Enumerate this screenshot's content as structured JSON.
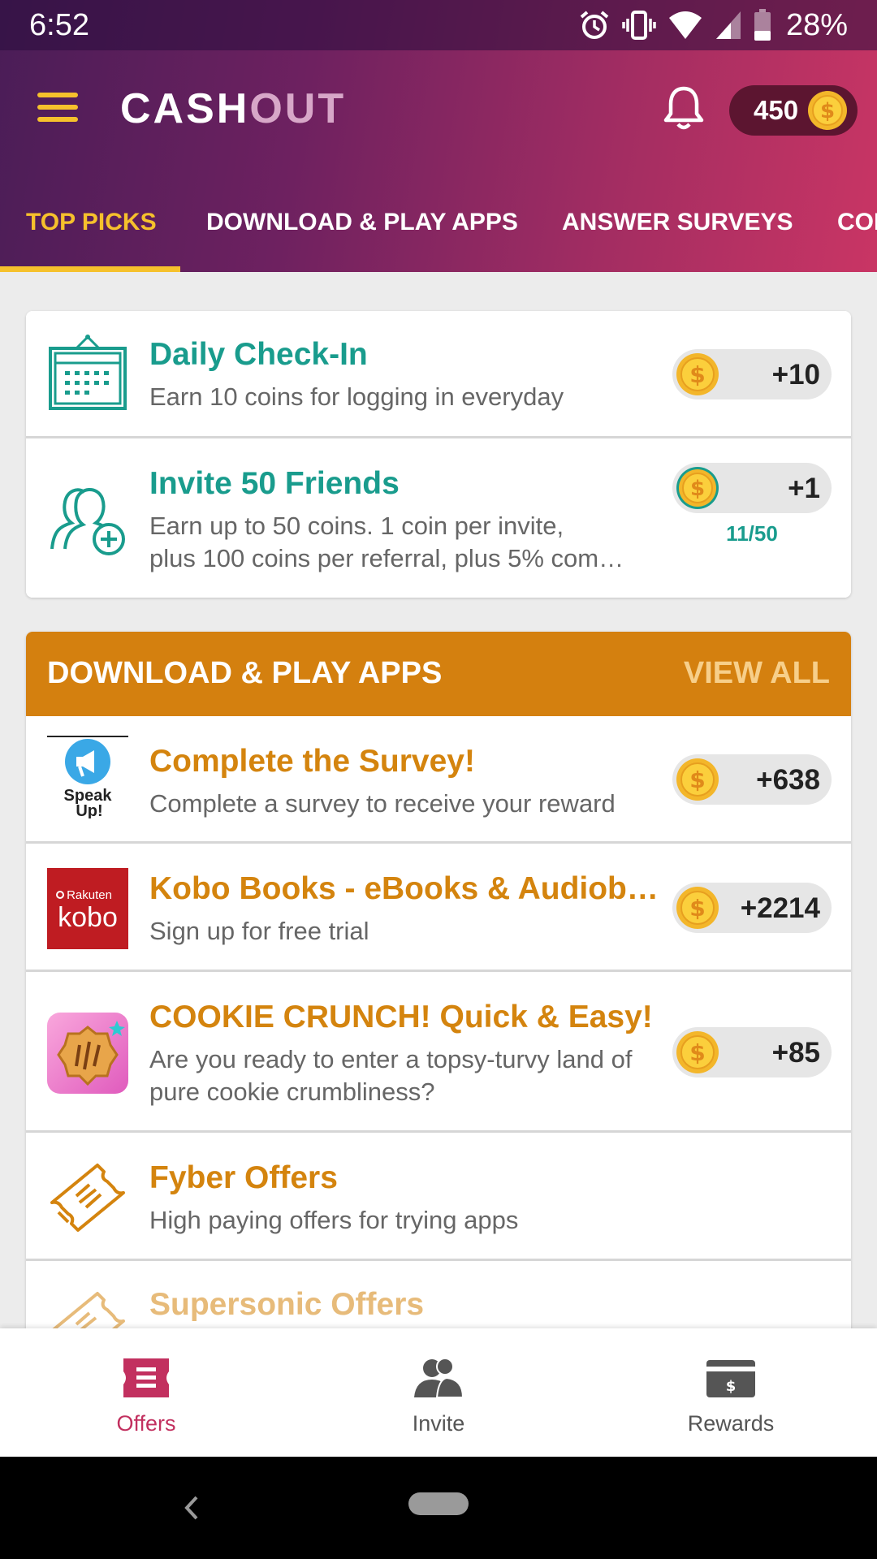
{
  "status_bar": {
    "time": "6:52",
    "battery": "28%"
  },
  "app": {
    "logo_part1": "CASH",
    "logo_part2": "OUT",
    "coin_balance": "450"
  },
  "tabs": [
    {
      "label": "TOP PICKS",
      "active": true
    },
    {
      "label": "DOWNLOAD & PLAY APPS"
    },
    {
      "label": "ANSWER SURVEYS"
    },
    {
      "label": "COI"
    }
  ],
  "top_picks": [
    {
      "title": "Daily Check-In",
      "desc": "Earn 10 coins for logging in everyday",
      "reward": "+10",
      "icon": "calendar-icon"
    },
    {
      "title": "Invite 50 Friends",
      "desc_line1": "Earn up to 50 coins. 1 coin per invite,",
      "desc_line2": "plus 100 coins per referral, plus 5% com…",
      "reward": "+1",
      "progress": "11/50",
      "progress_fraction": 0.22,
      "icon": "add-friend-icon"
    }
  ],
  "apps_section": {
    "title": "DOWNLOAD & PLAY APPS",
    "view_all": "VIEW ALL",
    "items": [
      {
        "title": "Complete the Survey!",
        "desc": "Complete a survey to receive your reward",
        "reward": "+638",
        "icon": "speak-up-icon",
        "icon_text_1": "Speak",
        "icon_text_2": "Up!"
      },
      {
        "title": "Kobo Books - eBooks & Audiobooks",
        "desc": "Sign up for free trial",
        "reward": "+2214",
        "icon": "kobo-icon",
        "icon_text_1": "Rakuten",
        "icon_text_2": "kobo"
      },
      {
        "title": "COOKIE CRUNCH! Quick & Easy!",
        "desc_line1": "Are you ready to enter a topsy-turvy land of",
        "desc_line2": "pure cookie crumbliness?",
        "reward": "+85",
        "icon": "cookie-icon"
      },
      {
        "title": "Fyber Offers",
        "desc": "High paying offers for trying apps",
        "icon": "ticket-icon"
      },
      {
        "title": "Supersonic Offers",
        "icon": "ticket-icon"
      }
    ]
  },
  "bottom_nav": [
    {
      "label": "Offers",
      "icon": "offers-icon",
      "active": true
    },
    {
      "label": "Invite",
      "icon": "people-icon"
    },
    {
      "label": "Rewards",
      "icon": "wallet-icon"
    }
  ],
  "colors": {
    "accent_yellow": "#f6c12c",
    "teal": "#199c8d",
    "orange": "#d4840e",
    "section_header": "#d4800f",
    "active_nav": "#c2305f"
  }
}
